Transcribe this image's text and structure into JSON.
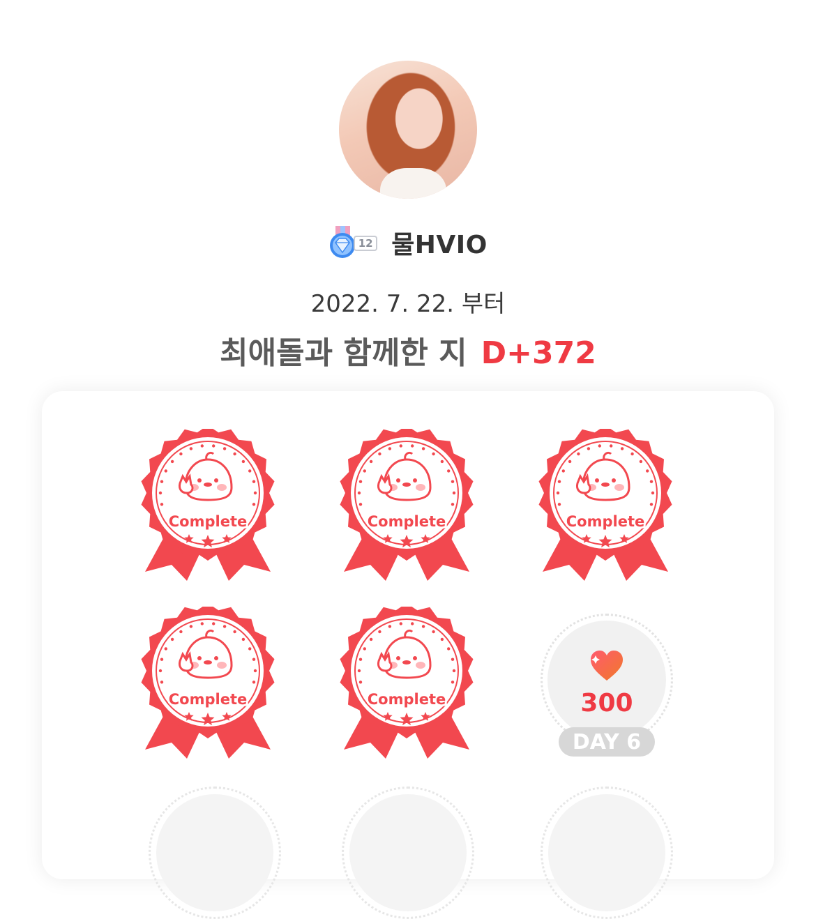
{
  "profile": {
    "nickname": "물HVIO",
    "level": "12",
    "since": "2022. 7. 22. 부터",
    "dday_label": "최애돌과 함께한 지",
    "dday_value": "D+372"
  },
  "stamps": [
    {
      "text": "Complete"
    },
    {
      "text": "Complete"
    },
    {
      "text": "Complete"
    },
    {
      "text": "Complete"
    },
    {
      "text": "Complete"
    }
  ],
  "reward": {
    "points": "300",
    "day": "DAY 6",
    "icon": "heart-icon"
  },
  "colors": {
    "accent": "#ef3a43",
    "stamp_red": "#f2484f",
    "text_dark": "#333333"
  }
}
